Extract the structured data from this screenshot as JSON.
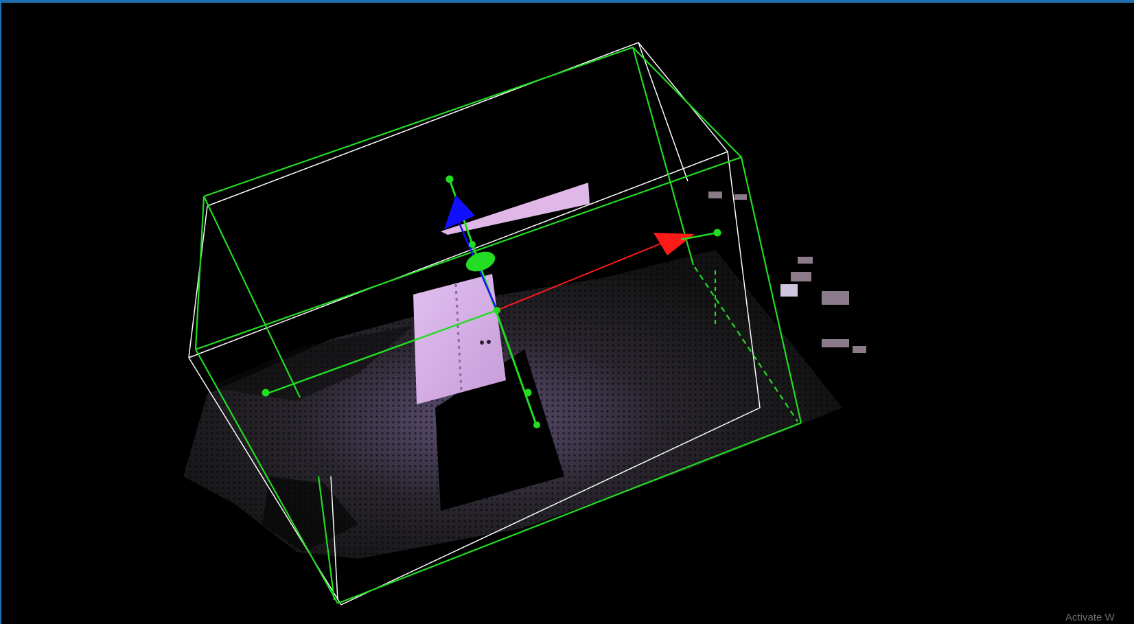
{
  "viewer": {
    "background": "#000000",
    "frame_color": "#1f6fb2",
    "bbox_color": "#22dd22",
    "bbox_outline_color": "#ffffff",
    "gizmo": {
      "x_axis_color": "#ff1a1a",
      "y_axis_color": "#22dd22",
      "z_axis_color": "#1010ff",
      "handle_color": "#22dd22"
    },
    "point_cloud_colors": [
      "#3a3a3a",
      "#c9a6d8",
      "#6b5a78",
      "#e8c8f0"
    ],
    "icons": [
      "rotate-ring-icon",
      "translate-x-arrow-icon",
      "translate-z-arrow-icon"
    ]
  },
  "watermark": {
    "text": "Activate W"
  }
}
